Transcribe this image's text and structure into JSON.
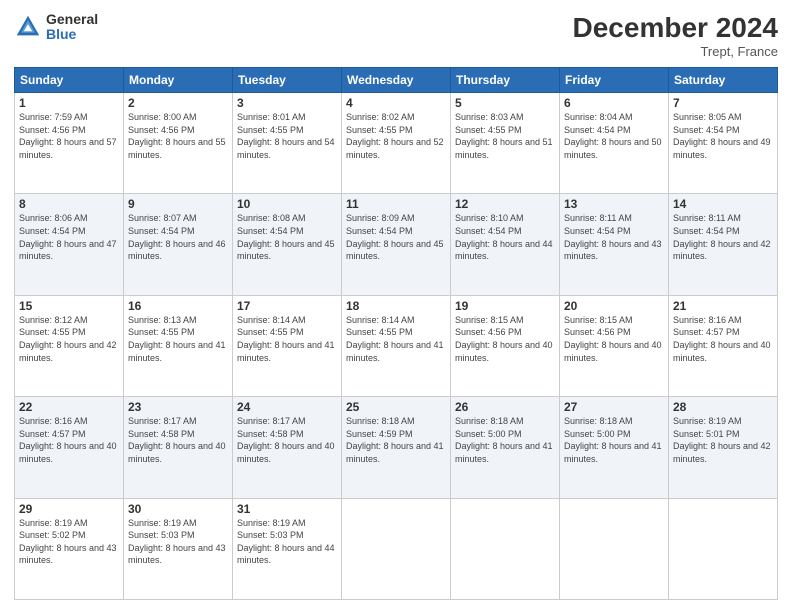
{
  "header": {
    "logo_general": "General",
    "logo_blue": "Blue",
    "month_title": "December 2024",
    "subtitle": "Trept, France"
  },
  "columns": [
    "Sunday",
    "Monday",
    "Tuesday",
    "Wednesday",
    "Thursday",
    "Friday",
    "Saturday"
  ],
  "weeks": [
    [
      {
        "day": "1",
        "sunrise": "Sunrise: 7:59 AM",
        "sunset": "Sunset: 4:56 PM",
        "daylight": "Daylight: 8 hours and 57 minutes."
      },
      {
        "day": "2",
        "sunrise": "Sunrise: 8:00 AM",
        "sunset": "Sunset: 4:56 PM",
        "daylight": "Daylight: 8 hours and 55 minutes."
      },
      {
        "day": "3",
        "sunrise": "Sunrise: 8:01 AM",
        "sunset": "Sunset: 4:55 PM",
        "daylight": "Daylight: 8 hours and 54 minutes."
      },
      {
        "day": "4",
        "sunrise": "Sunrise: 8:02 AM",
        "sunset": "Sunset: 4:55 PM",
        "daylight": "Daylight: 8 hours and 52 minutes."
      },
      {
        "day": "5",
        "sunrise": "Sunrise: 8:03 AM",
        "sunset": "Sunset: 4:55 PM",
        "daylight": "Daylight: 8 hours and 51 minutes."
      },
      {
        "day": "6",
        "sunrise": "Sunrise: 8:04 AM",
        "sunset": "Sunset: 4:54 PM",
        "daylight": "Daylight: 8 hours and 50 minutes."
      },
      {
        "day": "7",
        "sunrise": "Sunrise: 8:05 AM",
        "sunset": "Sunset: 4:54 PM",
        "daylight": "Daylight: 8 hours and 49 minutes."
      }
    ],
    [
      {
        "day": "8",
        "sunrise": "Sunrise: 8:06 AM",
        "sunset": "Sunset: 4:54 PM",
        "daylight": "Daylight: 8 hours and 47 minutes."
      },
      {
        "day": "9",
        "sunrise": "Sunrise: 8:07 AM",
        "sunset": "Sunset: 4:54 PM",
        "daylight": "Daylight: 8 hours and 46 minutes."
      },
      {
        "day": "10",
        "sunrise": "Sunrise: 8:08 AM",
        "sunset": "Sunset: 4:54 PM",
        "daylight": "Daylight: 8 hours and 45 minutes."
      },
      {
        "day": "11",
        "sunrise": "Sunrise: 8:09 AM",
        "sunset": "Sunset: 4:54 PM",
        "daylight": "Daylight: 8 hours and 45 minutes."
      },
      {
        "day": "12",
        "sunrise": "Sunrise: 8:10 AM",
        "sunset": "Sunset: 4:54 PM",
        "daylight": "Daylight: 8 hours and 44 minutes."
      },
      {
        "day": "13",
        "sunrise": "Sunrise: 8:11 AM",
        "sunset": "Sunset: 4:54 PM",
        "daylight": "Daylight: 8 hours and 43 minutes."
      },
      {
        "day": "14",
        "sunrise": "Sunrise: 8:11 AM",
        "sunset": "Sunset: 4:54 PM",
        "daylight": "Daylight: 8 hours and 42 minutes."
      }
    ],
    [
      {
        "day": "15",
        "sunrise": "Sunrise: 8:12 AM",
        "sunset": "Sunset: 4:55 PM",
        "daylight": "Daylight: 8 hours and 42 minutes."
      },
      {
        "day": "16",
        "sunrise": "Sunrise: 8:13 AM",
        "sunset": "Sunset: 4:55 PM",
        "daylight": "Daylight: 8 hours and 41 minutes."
      },
      {
        "day": "17",
        "sunrise": "Sunrise: 8:14 AM",
        "sunset": "Sunset: 4:55 PM",
        "daylight": "Daylight: 8 hours and 41 minutes."
      },
      {
        "day": "18",
        "sunrise": "Sunrise: 8:14 AM",
        "sunset": "Sunset: 4:55 PM",
        "daylight": "Daylight: 8 hours and 41 minutes."
      },
      {
        "day": "19",
        "sunrise": "Sunrise: 8:15 AM",
        "sunset": "Sunset: 4:56 PM",
        "daylight": "Daylight: 8 hours and 40 minutes."
      },
      {
        "day": "20",
        "sunrise": "Sunrise: 8:15 AM",
        "sunset": "Sunset: 4:56 PM",
        "daylight": "Daylight: 8 hours and 40 minutes."
      },
      {
        "day": "21",
        "sunrise": "Sunrise: 8:16 AM",
        "sunset": "Sunset: 4:57 PM",
        "daylight": "Daylight: 8 hours and 40 minutes."
      }
    ],
    [
      {
        "day": "22",
        "sunrise": "Sunrise: 8:16 AM",
        "sunset": "Sunset: 4:57 PM",
        "daylight": "Daylight: 8 hours and 40 minutes."
      },
      {
        "day": "23",
        "sunrise": "Sunrise: 8:17 AM",
        "sunset": "Sunset: 4:58 PM",
        "daylight": "Daylight: 8 hours and 40 minutes."
      },
      {
        "day": "24",
        "sunrise": "Sunrise: 8:17 AM",
        "sunset": "Sunset: 4:58 PM",
        "daylight": "Daylight: 8 hours and 40 minutes."
      },
      {
        "day": "25",
        "sunrise": "Sunrise: 8:18 AM",
        "sunset": "Sunset: 4:59 PM",
        "daylight": "Daylight: 8 hours and 41 minutes."
      },
      {
        "day": "26",
        "sunrise": "Sunrise: 8:18 AM",
        "sunset": "Sunset: 5:00 PM",
        "daylight": "Daylight: 8 hours and 41 minutes."
      },
      {
        "day": "27",
        "sunrise": "Sunrise: 8:18 AM",
        "sunset": "Sunset: 5:00 PM",
        "daylight": "Daylight: 8 hours and 41 minutes."
      },
      {
        "day": "28",
        "sunrise": "Sunrise: 8:19 AM",
        "sunset": "Sunset: 5:01 PM",
        "daylight": "Daylight: 8 hours and 42 minutes."
      }
    ],
    [
      {
        "day": "29",
        "sunrise": "Sunrise: 8:19 AM",
        "sunset": "Sunset: 5:02 PM",
        "daylight": "Daylight: 8 hours and 43 minutes."
      },
      {
        "day": "30",
        "sunrise": "Sunrise: 8:19 AM",
        "sunset": "Sunset: 5:03 PM",
        "daylight": "Daylight: 8 hours and 43 minutes."
      },
      {
        "day": "31",
        "sunrise": "Sunrise: 8:19 AM",
        "sunset": "Sunset: 5:03 PM",
        "daylight": "Daylight: 8 hours and 44 minutes."
      },
      null,
      null,
      null,
      null
    ]
  ]
}
